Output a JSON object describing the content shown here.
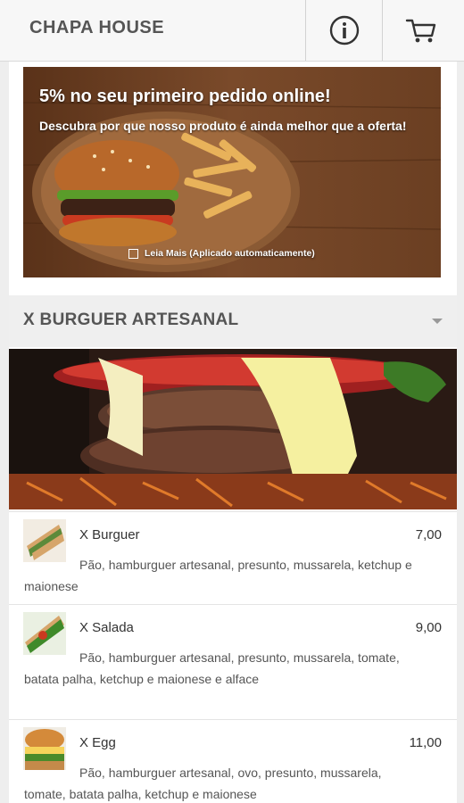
{
  "header": {
    "brand": "CHAPA HOUSE",
    "info_icon": "info-circle-icon",
    "cart_icon": "shopping-cart-icon"
  },
  "promo": {
    "title": "5% no seu primeiro pedido online!",
    "subtitle": "Descubra por que nosso produto é ainda melhor que a oferta!",
    "link": "Leia Mais (Aplicado automaticamente)"
  },
  "category": {
    "title": "X BURGUER ARTESANAL"
  },
  "items": [
    {
      "name": "X Burguer",
      "price": "7,00",
      "description": "Pão, hamburguer artesanal, presunto, mussarela, ketchup e maionese"
    },
    {
      "name": "X Salada",
      "price": "9,00",
      "description": "Pão, hamburguer artesanal, presunto, mussarela, tomate, batata palha, ketchup e maionese e alface"
    },
    {
      "name": "X Egg",
      "price": "11,00",
      "description": "Pão, hamburguer artesanal, ovo, presunto, mussarela, tomate, batata palha, ketchup e maionese"
    }
  ],
  "colors": {
    "background": "#eeeeee",
    "header_text": "#555555",
    "promo_wood": "#6b3f22"
  }
}
